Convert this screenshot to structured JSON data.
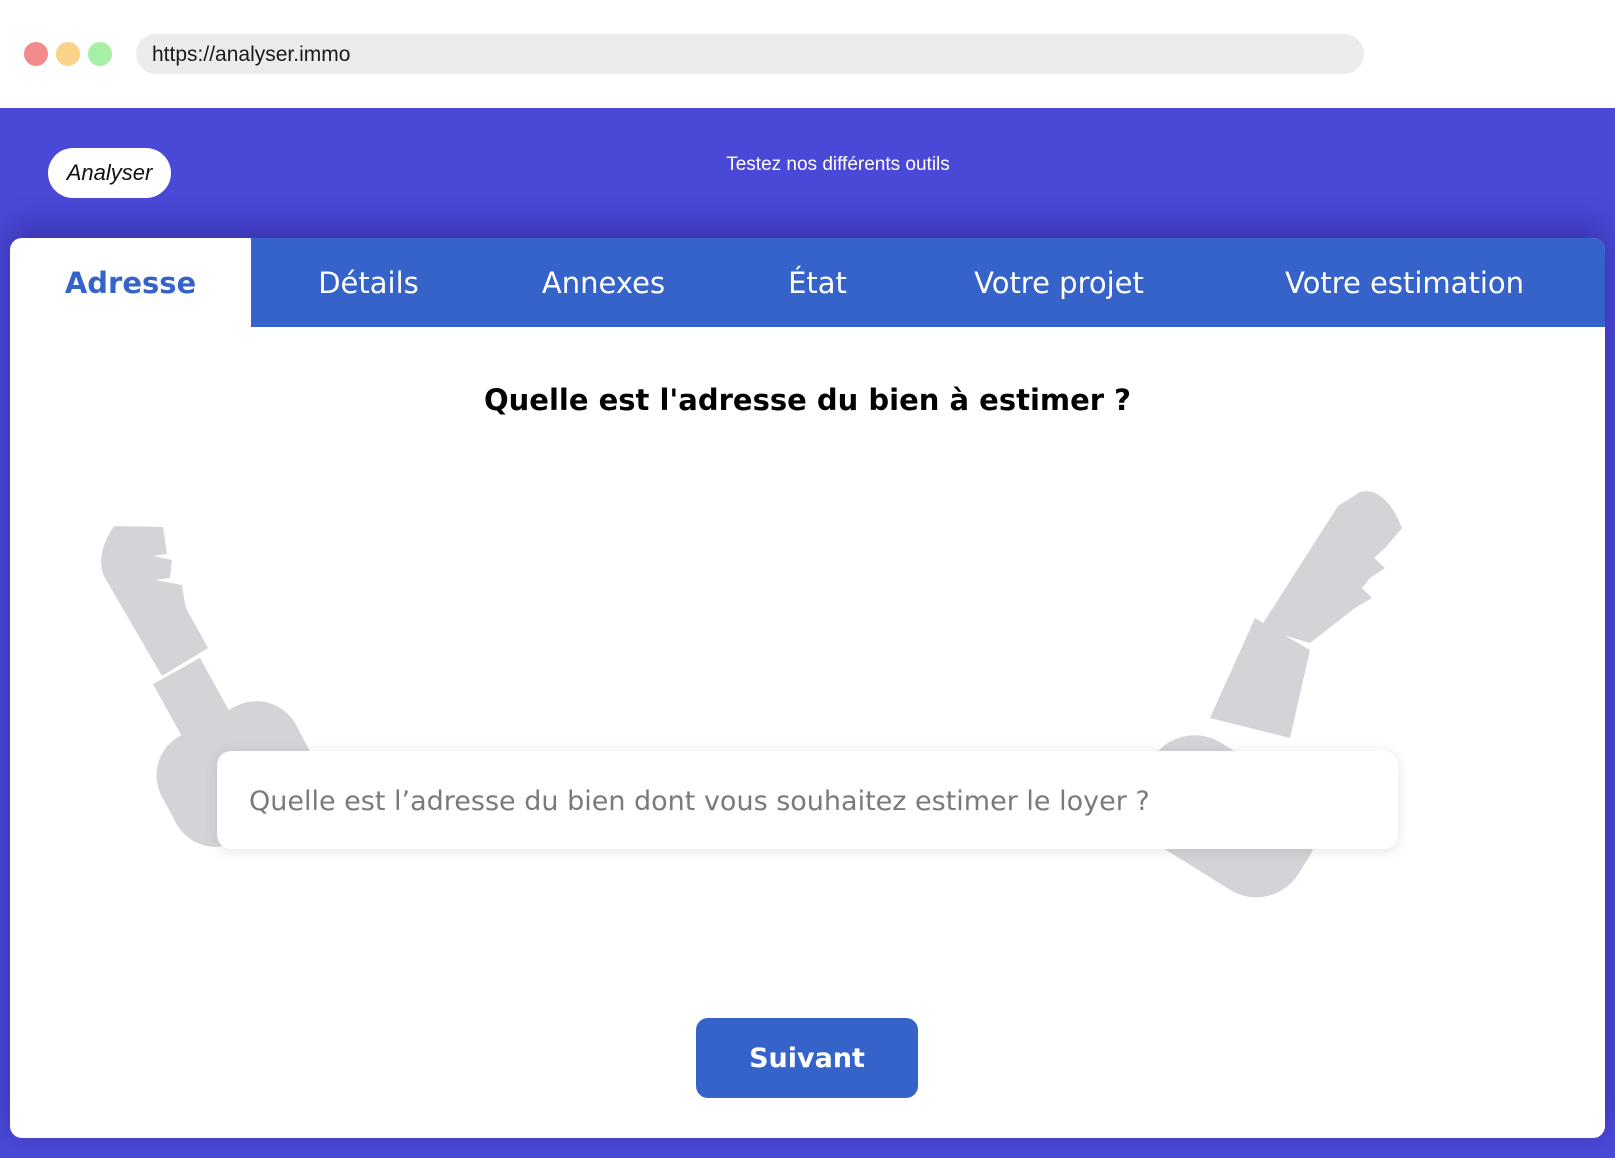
{
  "browser": {
    "url": "https://analyser.immo",
    "traffic_lights": [
      "#f28b8b",
      "#f9d38a",
      "#a6f0a6"
    ]
  },
  "header": {
    "logo": "Analyser",
    "tagline": "Testez nos différents outils"
  },
  "tabs": [
    {
      "label": "Adresse",
      "active": true
    },
    {
      "label": "Détails",
      "active": false
    },
    {
      "label": "Annexes",
      "active": false
    },
    {
      "label": "État",
      "active": false
    },
    {
      "label": "Votre projet",
      "active": false
    },
    {
      "label": "Votre estimation",
      "active": false
    }
  ],
  "main": {
    "question": "Quelle est l'adresse du bien à estimer ?",
    "address_input": {
      "value": "",
      "placeholder": "Quelle est l’adresse du bien dont vous souhaitez estimer le loyer ?"
    },
    "next_label": "Suivant"
  },
  "icons": {
    "left_decoration": "key-icon",
    "right_decoration": "key-icon"
  },
  "colors": {
    "page_background": "#4a48d6",
    "tab_bar": "#3563c9",
    "active_tab_text": "#3563c9",
    "button": "#3563c9",
    "key_decoration": "#d4d4d8"
  }
}
